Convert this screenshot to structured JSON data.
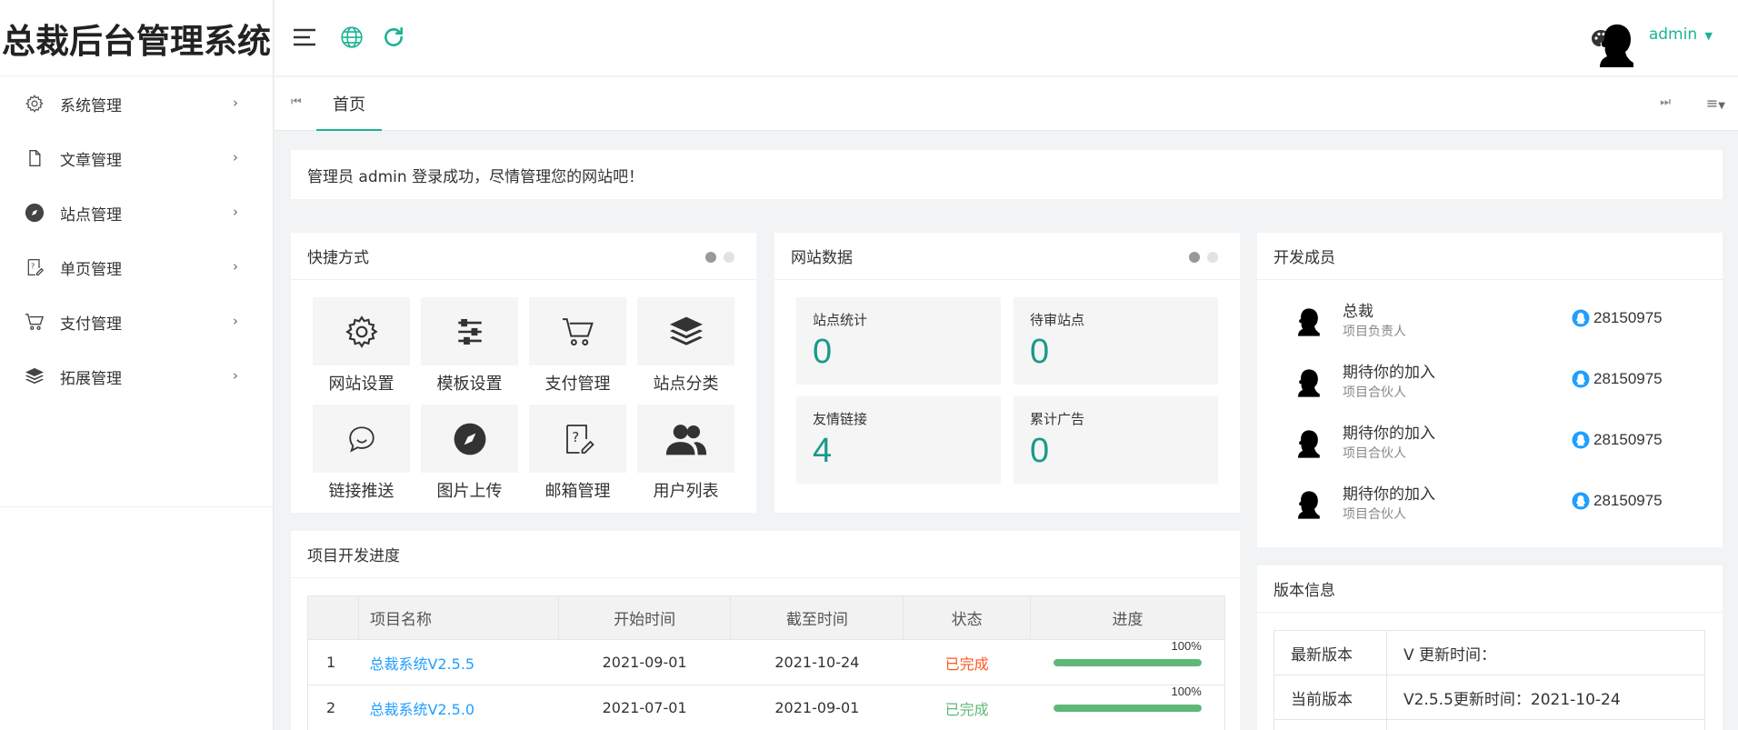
{
  "app": {
    "title": "总裁后台管理系统"
  },
  "header": {
    "admin_name": "admin"
  },
  "sidebar": {
    "items": [
      {
        "label": "系统管理",
        "icon": "gear-icon"
      },
      {
        "label": "文章管理",
        "icon": "document-icon"
      },
      {
        "label": "站点管理",
        "icon": "compass-icon"
      },
      {
        "label": "单页管理",
        "icon": "help-doc-icon"
      },
      {
        "label": "支付管理",
        "icon": "cart-icon"
      },
      {
        "label": "拓展管理",
        "icon": "layers-icon"
      }
    ]
  },
  "tabs": {
    "home": "首页"
  },
  "notice": "管理员 admin 登录成功，尽情管理您的网站吧！",
  "quick": {
    "title": "快捷方式",
    "items": [
      {
        "label": "网站设置",
        "icon": "gear-icon"
      },
      {
        "label": "模板设置",
        "icon": "sliders-icon"
      },
      {
        "label": "支付管理",
        "icon": "cart-icon"
      },
      {
        "label": "站点分类",
        "icon": "layers-icon"
      },
      {
        "label": "链接推送",
        "icon": "chat-bubble-icon"
      },
      {
        "label": "图片上传",
        "icon": "compass-icon"
      },
      {
        "label": "邮箱管理",
        "icon": "help-edit-icon"
      },
      {
        "label": "用户列表",
        "icon": "users-icon"
      }
    ]
  },
  "stats": {
    "title": "网站数据",
    "items": [
      {
        "label": "站点统计",
        "value": "0"
      },
      {
        "label": "待审站点",
        "value": "0"
      },
      {
        "label": "友情链接",
        "value": "4"
      },
      {
        "label": "累计广告",
        "value": "0"
      }
    ]
  },
  "members": {
    "title": "开发成员",
    "items": [
      {
        "name": "总裁",
        "role": "项目负责人",
        "qq": "28150975"
      },
      {
        "name": "期待你的加入",
        "role": "项目合伙人",
        "qq": "28150975"
      },
      {
        "name": "期待你的加入",
        "role": "项目合伙人",
        "qq": "28150975"
      },
      {
        "name": "期待你的加入",
        "role": "项目合伙人",
        "qq": "28150975"
      }
    ]
  },
  "progress": {
    "title": "项目开发进度",
    "headers": [
      "项目名称",
      "开始时间",
      "截至时间",
      "状态",
      "进度"
    ],
    "rows": [
      {
        "no": "1",
        "name": "总裁系统V2.5.5",
        "start": "2021-09-01",
        "end": "2021-10-24",
        "status": "已完成",
        "progress": 100,
        "progress_label": "100%",
        "status_color": "#ff5722"
      },
      {
        "no": "2",
        "name": "总裁系统V2.5.0",
        "start": "2021-07-01",
        "end": "2021-09-01",
        "status": "已完成",
        "progress": 100,
        "progress_label": "100%",
        "status_color": "#5fb878"
      }
    ]
  },
  "version": {
    "title": "版本信息",
    "rows": [
      {
        "label": "最新版本",
        "value": "V 更新时间："
      },
      {
        "label": "当前版本",
        "value": "V2.5.5更新时间：2021-10-24"
      }
    ]
  },
  "colors": {
    "accent": "#1ab394",
    "link": "#1e9fff",
    "stat_value": "#1a9a8a"
  }
}
